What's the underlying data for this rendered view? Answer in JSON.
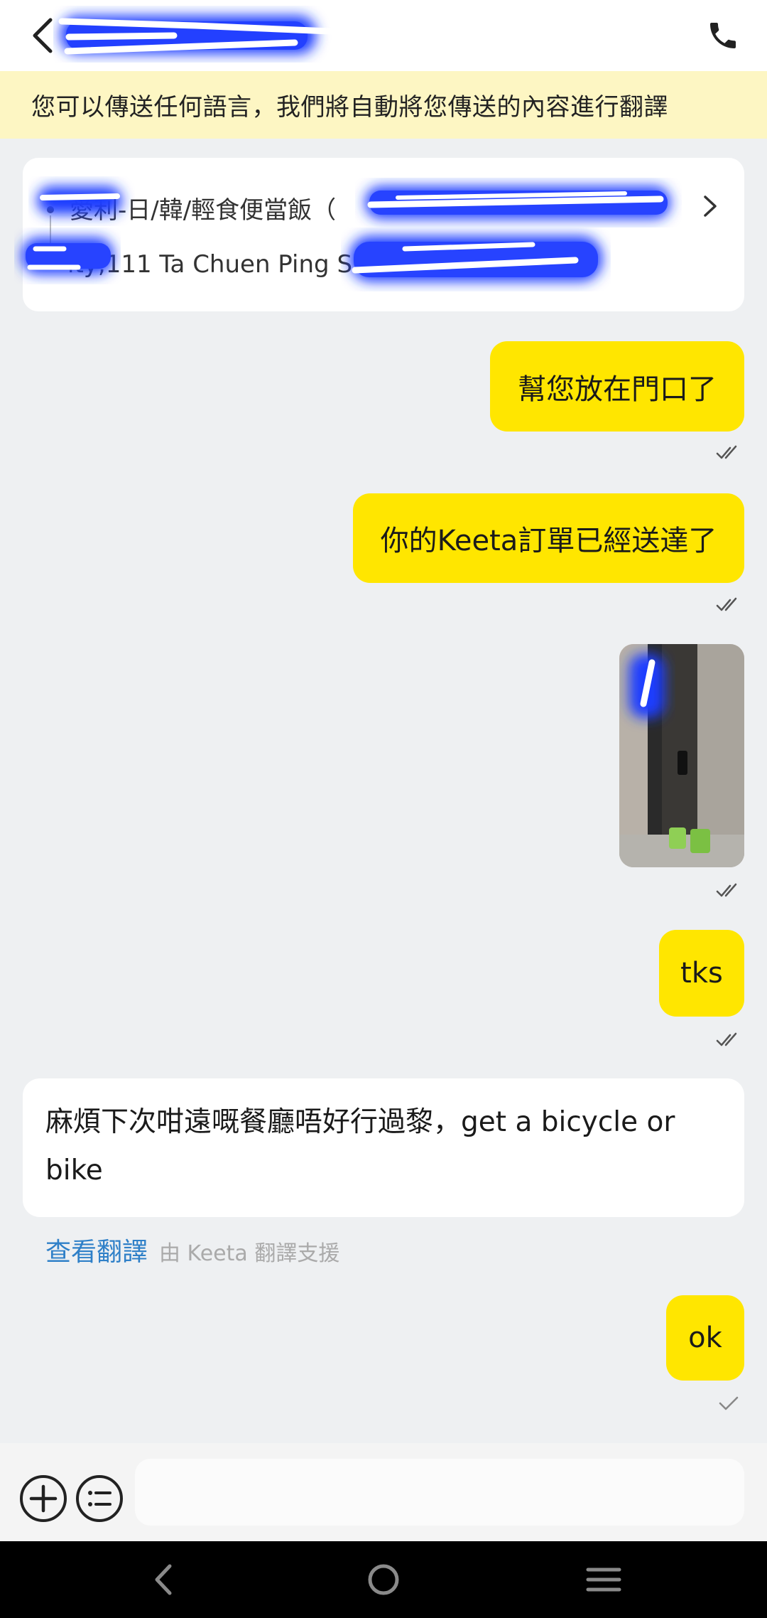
{
  "notice": {
    "text": "您可以傳送任何語言，我們將自動將您傳送的內容進行翻譯"
  },
  "order_card": {
    "restaurant": "愛利-日/韓/輕食便當飯（",
    "address": "ity,111 Ta Chuen Ping S"
  },
  "messages": [
    {
      "text": "幫您放在門口了",
      "status": "read"
    },
    {
      "text": "你的Keeta訂單已經送達了",
      "status": "read"
    },
    {
      "type": "image",
      "status": "read"
    },
    {
      "text": "tks",
      "status": "read"
    },
    {
      "text": "ok",
      "status": "sent"
    }
  ],
  "incoming": {
    "text": "麻煩下次咁遠嘅餐廳唔好行過黎，get a bicycle or bike",
    "translate_link": "查看翻譯",
    "translate_note": "由 Keeta 翻譯支援"
  },
  "input": {
    "placeholder": ""
  },
  "colors": {
    "bubble_out": "#ffe600",
    "notice_bg": "#fdf6c3",
    "link": "#2f80c8",
    "redaction": "#1d3cff"
  },
  "icons": [
    "back-icon",
    "phone-icon",
    "chevron-right-icon",
    "double-check-icon",
    "single-check-icon",
    "plus-icon",
    "list-icon",
    "nav-back-icon",
    "nav-home-icon",
    "nav-recents-icon"
  ]
}
